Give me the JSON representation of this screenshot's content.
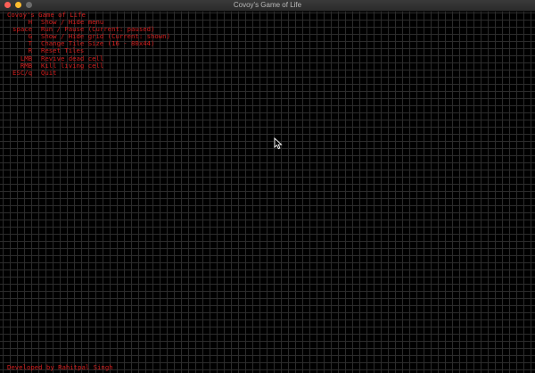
{
  "window": {
    "title": "Covoy's Game of Life"
  },
  "menu": {
    "title": "Covoy's Game of Life",
    "items": [
      {
        "key": "H",
        "desc": "Show / Hide menu"
      },
      {
        "key": "space",
        "desc": "Run / Pause (Current: paused)"
      },
      {
        "key": "G",
        "desc": "Show / Hide grid (Current: shown)"
      },
      {
        "key": "T",
        "desc": "Change Tile Size (16 - 80x44)"
      },
      {
        "key": "R",
        "desc": "Reset Tiles"
      },
      {
        "key": "LMB",
        "desc": "Revive dead cell"
      },
      {
        "key": "RMB",
        "desc": "Kill living cell"
      },
      {
        "key": "ESC/q",
        "desc": "Quit"
      }
    ]
  },
  "footer": {
    "text": "Developed by Rahitpal Singh"
  },
  "colors": {
    "text": "#d41d1d",
    "grid": "#2c2c2c",
    "background": "#000000"
  },
  "icons": {
    "cursor": "arrow-cursor-icon"
  }
}
